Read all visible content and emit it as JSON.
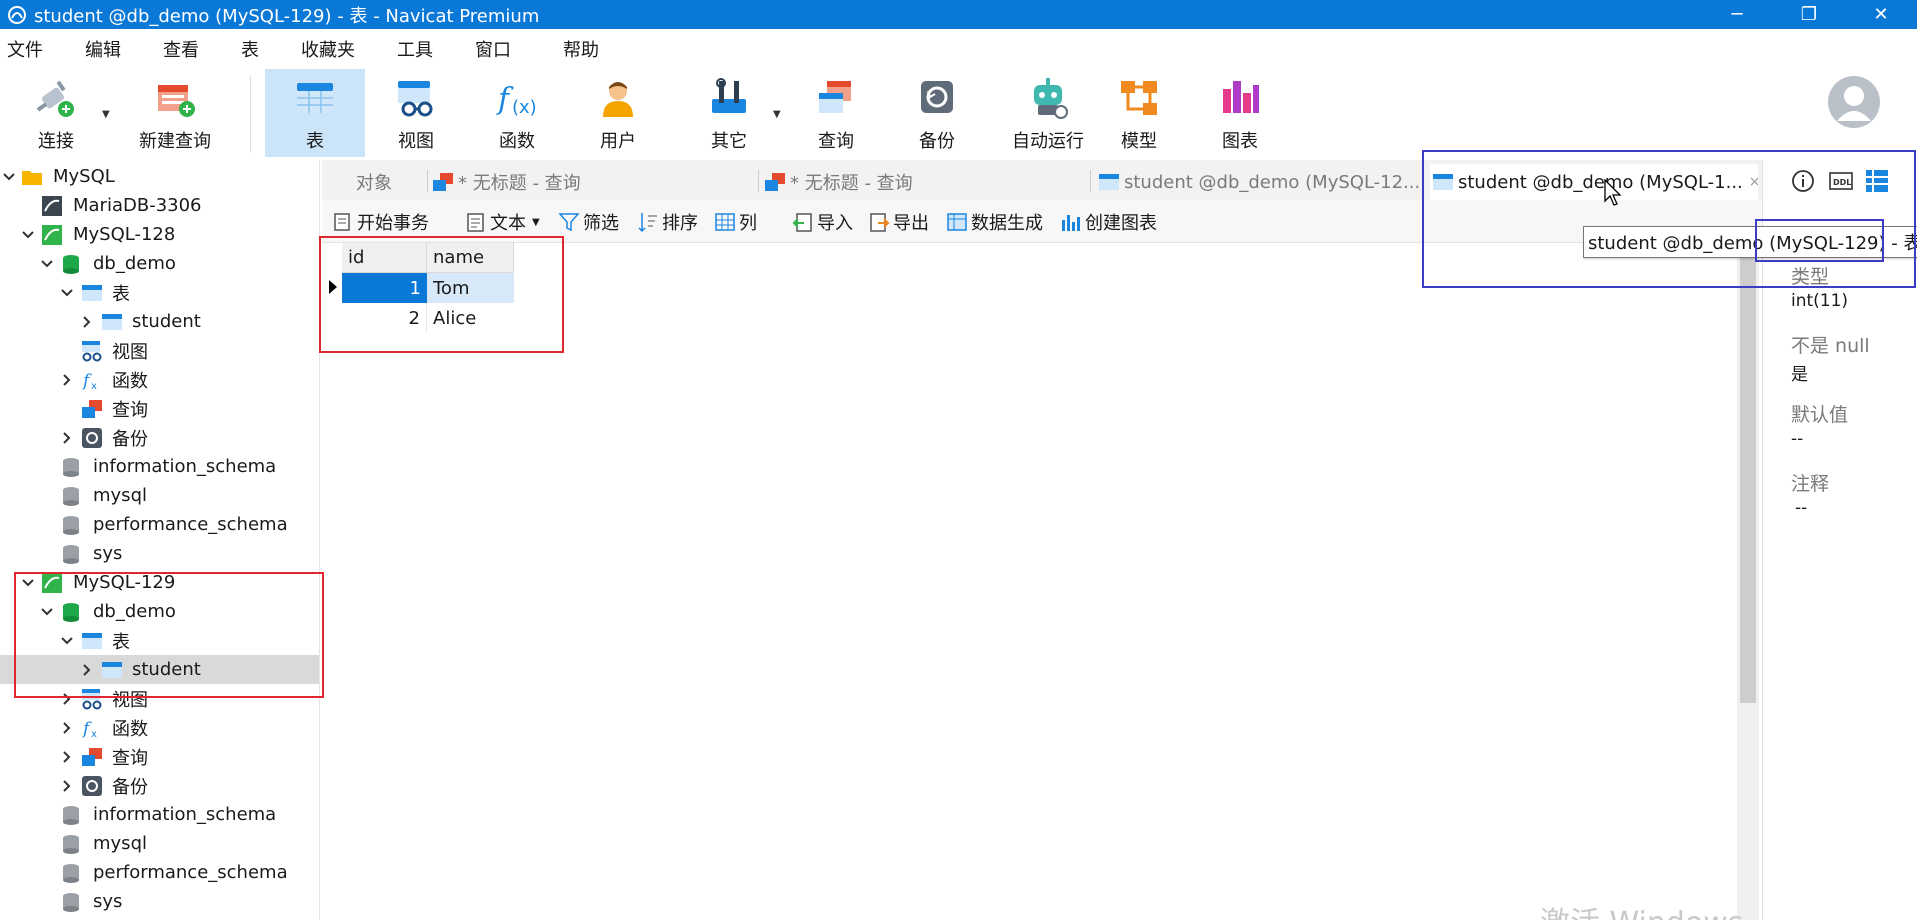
{
  "window": {
    "title": "student @db_demo (MySQL-129) - 表 - Navicat Premium",
    "controls": {
      "minimize": "─",
      "restore": "❐",
      "close": "✕"
    }
  },
  "menu": [
    "文件",
    "编辑",
    "查看",
    "表",
    "收藏夹",
    "工具",
    "窗口",
    "帮助"
  ],
  "toolbar": {
    "connect": "连接",
    "new_query": "新建查询",
    "table": "表",
    "view": "视图",
    "function": "函数",
    "user": "用户",
    "other": "其它",
    "query": "查询",
    "backup": "备份",
    "automation": "自动运行",
    "model": "模型",
    "chart": "图表"
  },
  "tree": {
    "root": "MySQL",
    "mariadb": "MariaDB-3306",
    "mysql128": {
      "name": "MySQL-128",
      "db": "db_demo",
      "tables": "表",
      "student": "student",
      "views": "视图",
      "functions": "函数",
      "queries": "查询",
      "backups": "备份",
      "information_schema": "information_schema",
      "mysql": "mysql",
      "performance_schema": "performance_schema",
      "sys": "sys"
    },
    "mysql129": {
      "name": "MySQL-129",
      "db": "db_demo",
      "tables": "表",
      "student": "student",
      "views": "视图",
      "functions": "函数",
      "queries": "查询",
      "backups": "备份",
      "information_schema": "information_schema",
      "mysql": "mysql",
      "performance_schema": "performance_schema",
      "sys": "sys"
    }
  },
  "tabs": {
    "objects": "对象",
    "query1": "* 无标题 - 查询",
    "query2": "* 无标题 - 查询",
    "student128": "student @db_demo (MySQL-12...",
    "student129": "student @db_demo (MySQL-1...",
    "close": "×"
  },
  "tooltip": {
    "text": "student @db_demo (MySQL-129) - 表"
  },
  "objbar": {
    "begin_tx": "开始事务",
    "text": "文本",
    "filter": "筛选",
    "sort": "排序",
    "columns": "列",
    "import": "导入",
    "export": "导出",
    "generate": "数据生成",
    "create_chart": "创建图表"
  },
  "grid": {
    "columns": [
      "id",
      "name"
    ],
    "rows": [
      {
        "id": "1",
        "name": "Tom"
      },
      {
        "id": "2",
        "name": "Alice"
      }
    ]
  },
  "info": {
    "type_label": "类型",
    "type_value": "int(11)",
    "notnull_label": "不是 null",
    "notnull_value": "是",
    "default_label": "默认值",
    "default_value": "--",
    "comment_label": "注释",
    "comment_value": "--"
  },
  "watermark": "激活 Windows",
  "colors": {
    "titlebar": "#0a78d7",
    "selection": "#0a78d7",
    "highlight_red": "#e0262e",
    "highlight_blue": "#3b3bc4"
  }
}
